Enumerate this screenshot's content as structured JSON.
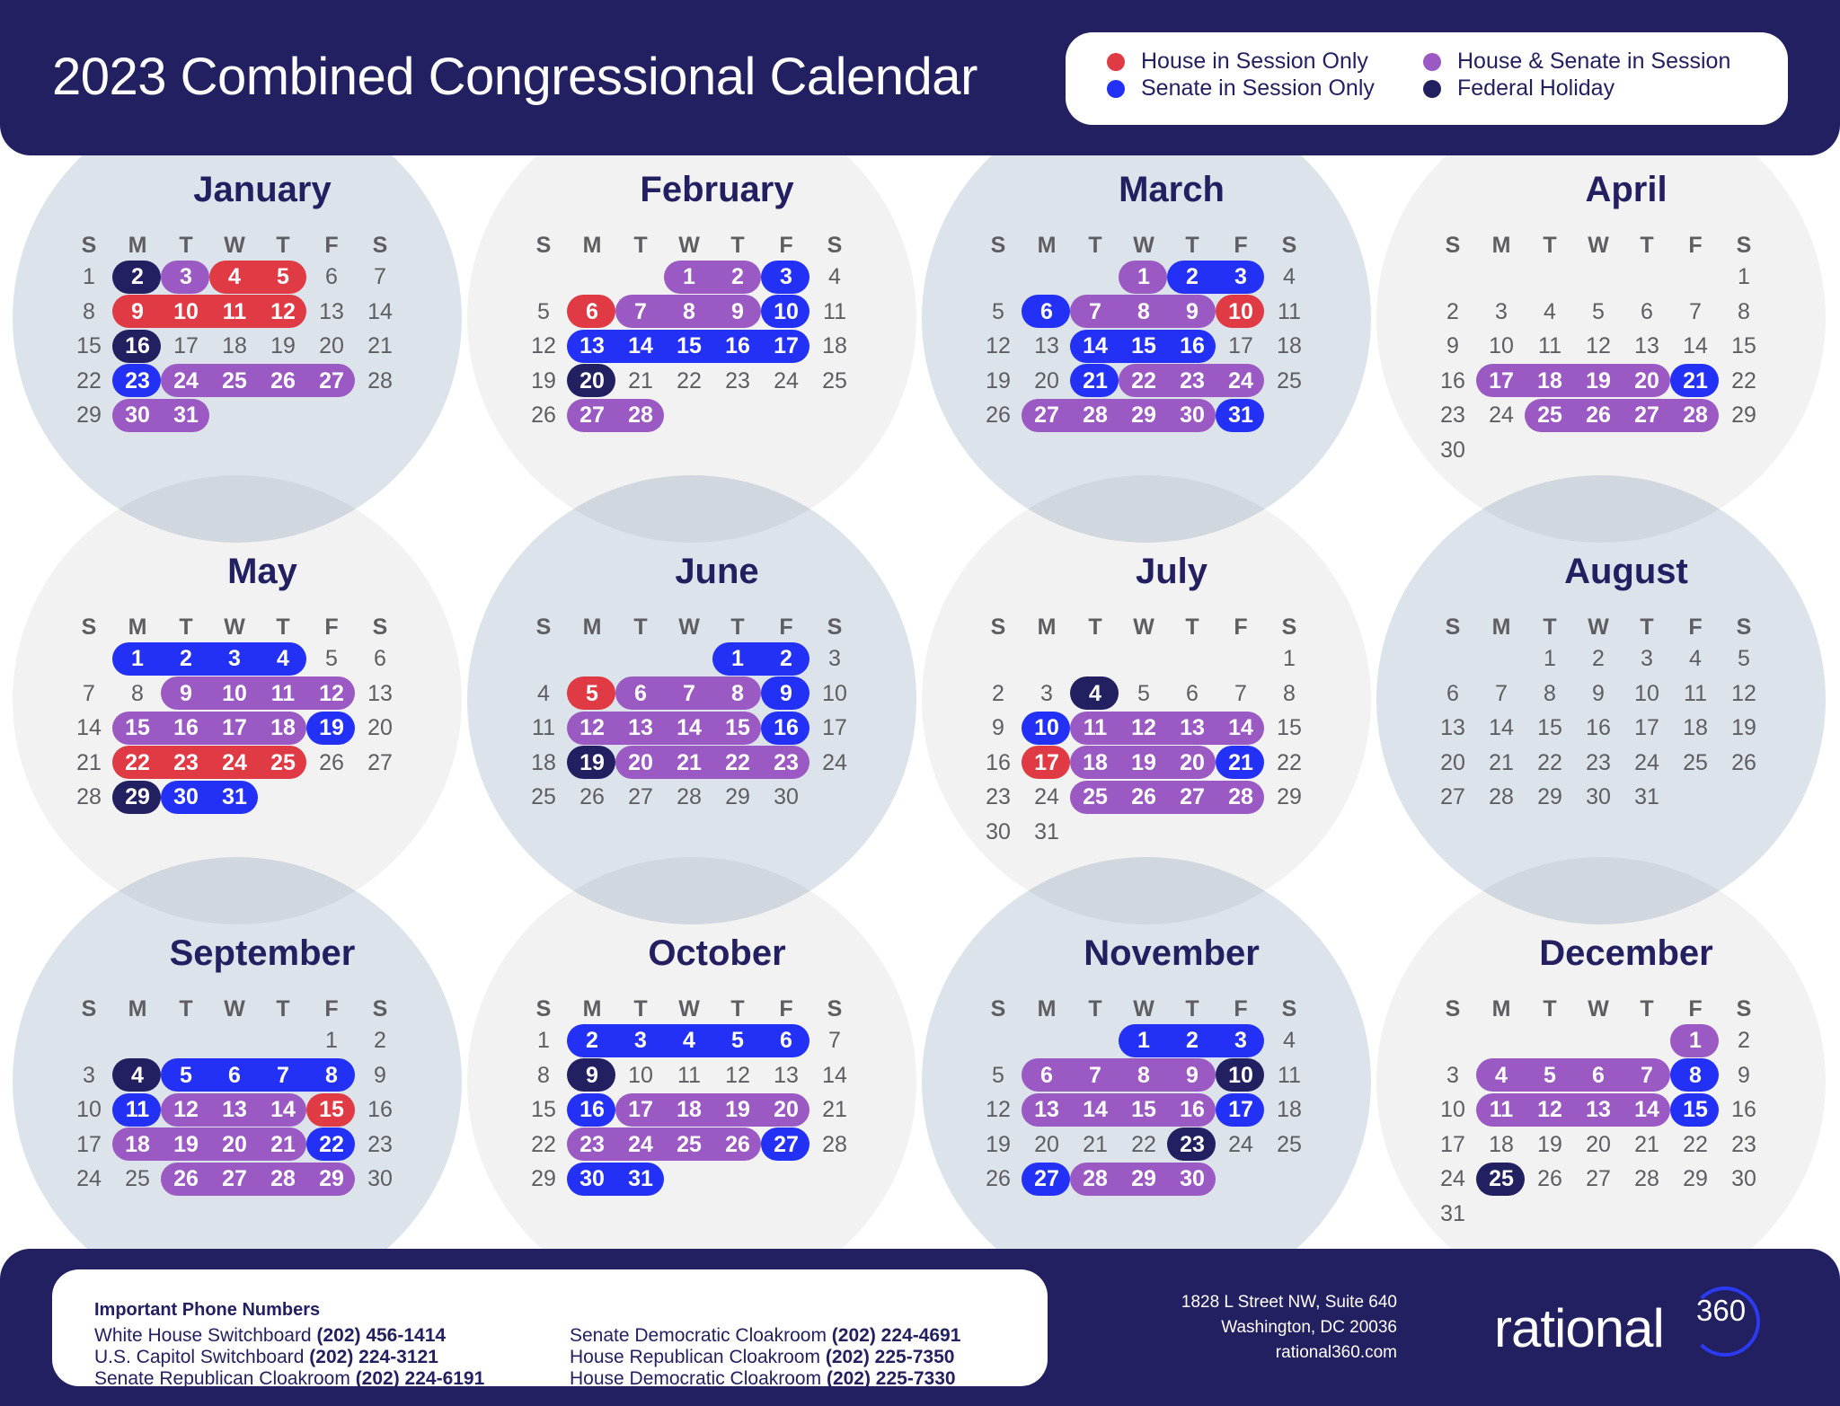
{
  "header": {
    "title": "2023 Combined Congressional Calendar"
  },
  "colors": {
    "navy": "#232062",
    "house": "#e03a44",
    "senate": "#2330f5",
    "both": "#9b59c3",
    "holiday": "#232062",
    "circle_blue": "#dde3ea",
    "circle_grey": "#f2f2f2",
    "day_text": "#5e5e62"
  },
  "legend": [
    {
      "key": "house",
      "label": "House in Session Only",
      "color": "#e03a44"
    },
    {
      "key": "senate",
      "label": "Senate in Session Only",
      "color": "#2330f5"
    },
    {
      "key": "both",
      "label": "House & Senate in Session",
      "color": "#9b59c3"
    },
    {
      "key": "holiday",
      "label": "Federal Holiday",
      "color": "#232062"
    }
  ],
  "weekdays": [
    "S",
    "M",
    "T",
    "W",
    "T",
    "F",
    "S"
  ],
  "months": [
    {
      "name": "January",
      "days": 31,
      "start": 0,
      "holiday": [
        2,
        16
      ],
      "house": [
        4,
        5,
        9,
        10,
        11,
        12
      ],
      "senate": [
        23
      ],
      "both": [
        3,
        24,
        25,
        26,
        27,
        30,
        31
      ]
    },
    {
      "name": "February",
      "days": 28,
      "start": 3,
      "holiday": [
        20
      ],
      "house": [
        6
      ],
      "senate": [
        3,
        10,
        13,
        14,
        15,
        16,
        17
      ],
      "both": [
        1,
        2,
        7,
        8,
        9,
        27,
        28
      ]
    },
    {
      "name": "March",
      "days": 31,
      "start": 3,
      "holiday": [],
      "house": [
        10
      ],
      "senate": [
        2,
        3,
        6,
        14,
        15,
        16,
        21,
        31
      ],
      "both": [
        1,
        7,
        8,
        9,
        22,
        23,
        24,
        27,
        28,
        29,
        30
      ]
    },
    {
      "name": "April",
      "days": 30,
      "start": 6,
      "holiday": [],
      "house": [],
      "senate": [
        21
      ],
      "both": [
        17,
        18,
        19,
        20,
        25,
        26,
        27,
        28
      ]
    },
    {
      "name": "May",
      "days": 31,
      "start": 1,
      "holiday": [
        29
      ],
      "house": [
        22,
        23,
        24,
        25
      ],
      "senate": [
        1,
        2,
        3,
        4,
        19,
        30,
        31
      ],
      "both": [
        9,
        10,
        11,
        12,
        15,
        16,
        17,
        18
      ]
    },
    {
      "name": "June",
      "days": 30,
      "start": 4,
      "holiday": [
        19
      ],
      "house": [
        5
      ],
      "senate": [
        1,
        2,
        9,
        16
      ],
      "both": [
        6,
        7,
        8,
        12,
        13,
        14,
        15,
        20,
        21,
        22,
        23
      ]
    },
    {
      "name": "July",
      "days": 31,
      "start": 6,
      "holiday": [
        4
      ],
      "house": [
        17
      ],
      "senate": [
        10,
        21
      ],
      "both": [
        11,
        12,
        13,
        14,
        18,
        19,
        20,
        25,
        26,
        27,
        28
      ]
    },
    {
      "name": "August",
      "days": 31,
      "start": 2,
      "holiday": [],
      "house": [],
      "senate": [],
      "both": []
    },
    {
      "name": "September",
      "days": 30,
      "start": 5,
      "holiday": [
        4
      ],
      "house": [
        15
      ],
      "senate": [
        5,
        6,
        7,
        8,
        11,
        22
      ],
      "both": [
        12,
        13,
        14,
        18,
        19,
        20,
        21,
        26,
        27,
        28,
        29
      ]
    },
    {
      "name": "October",
      "days": 31,
      "start": 0,
      "holiday": [
        9
      ],
      "house": [],
      "senate": [
        2,
        3,
        4,
        5,
        6,
        16,
        27,
        30,
        31
      ],
      "both": [
        17,
        18,
        19,
        20,
        23,
        24,
        25,
        26
      ]
    },
    {
      "name": "November",
      "days": 30,
      "start": 3,
      "holiday": [
        10,
        23
      ],
      "house": [],
      "senate": [
        1,
        2,
        3,
        17,
        27
      ],
      "both": [
        6,
        7,
        8,
        9,
        13,
        14,
        15,
        16,
        28,
        29,
        30
      ]
    },
    {
      "name": "December",
      "days": 31,
      "start": 5,
      "holiday": [
        25
      ],
      "house": [],
      "senate": [
        8,
        15
      ],
      "both": [
        1,
        4,
        5,
        6,
        7,
        11,
        12,
        13,
        14
      ]
    }
  ],
  "phones": {
    "title": "Important Phone Numbers",
    "entries": [
      {
        "label": "White House Switchboard",
        "number": "(202) 456-1414"
      },
      {
        "label": "U.S. Capitol Switchboard",
        "number": "(202) 224-3121"
      },
      {
        "label": "Senate Republican Cloakroom",
        "number": "(202) 224-6191"
      },
      {
        "label": "Senate Democratic Cloakroom",
        "number": "(202) 224-4691"
      },
      {
        "label": "House Republican Cloakroom",
        "number": "(202) 225-7350"
      },
      {
        "label": "House Democratic Cloakroom",
        "number": "(202) 225-7330"
      }
    ]
  },
  "address": {
    "line1": "1828 L Street NW, Suite 640",
    "line2": "Washington, DC 20036",
    "website": "rational360.com"
  },
  "logo": {
    "word": "rational",
    "number": "360"
  }
}
